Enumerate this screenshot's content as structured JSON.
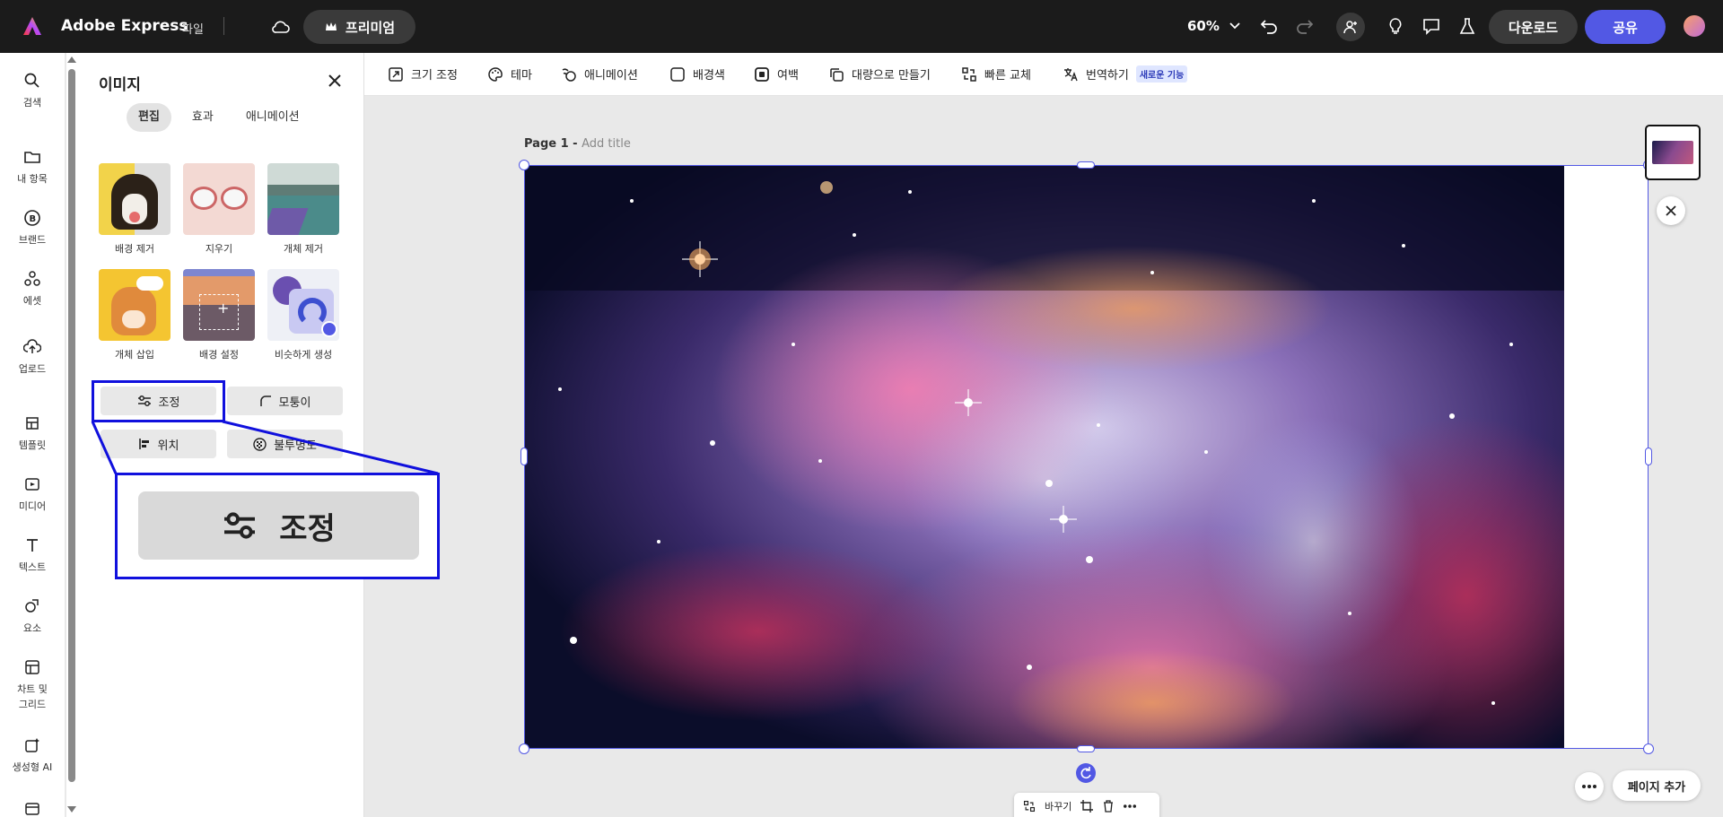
{
  "topbar": {
    "app_name": "Adobe Express",
    "file_menu": "파일",
    "premium_label": "프리미엄",
    "zoom": "60%",
    "download_label": "다운로드",
    "share_label": "공유"
  },
  "rail": {
    "items": [
      {
        "label": "검색",
        "icon": "search-icon"
      },
      {
        "label": "내 항목",
        "icon": "folder-icon"
      },
      {
        "label": "브랜드",
        "icon": "brand-icon"
      },
      {
        "label": "에셋",
        "icon": "assets-icon"
      },
      {
        "label": "업로드",
        "icon": "upload-icon"
      },
      {
        "label": "템플릿",
        "icon": "template-icon"
      },
      {
        "label": "미디어",
        "icon": "media-icon"
      },
      {
        "label": "텍스트",
        "icon": "text-icon"
      },
      {
        "label": "요소",
        "icon": "elements-icon"
      },
      {
        "label": "차트 및 그리드",
        "icon": "chart-grid-icon"
      },
      {
        "label": "생성형 AI",
        "icon": "genai-icon"
      }
    ]
  },
  "panel": {
    "title": "이미지",
    "tabs": [
      "편집",
      "효과",
      "애니메이션"
    ],
    "active_tab": "편집",
    "tools": [
      {
        "label": "배경 제거"
      },
      {
        "label": "지우기"
      },
      {
        "label": "개체 제거"
      },
      {
        "label": "개체 삽입"
      },
      {
        "label": "배경 설정"
      },
      {
        "label": "비슷하게 생성"
      }
    ],
    "buttons": {
      "adjust": "조정",
      "corners": "모퉁이",
      "position": "위치",
      "opacity": "불투명도"
    },
    "callout_label": "조정"
  },
  "toolbar": {
    "items": [
      "크기 조정",
      "테마",
      "애니메이션",
      "배경색",
      "여백",
      "대량으로 만들기",
      "빠른 교체",
      "번역하기"
    ],
    "new_badge": "새로운 기능"
  },
  "canvas": {
    "page_label": "Page 1 - ",
    "page_title_placeholder": "Add title",
    "add_page_label": "페이지 추가",
    "float_replace_label": "바꾸기"
  },
  "colors": {
    "accent": "#5258e4",
    "highlight": "#1010dd",
    "topbar_bg": "#1b1b1b"
  }
}
